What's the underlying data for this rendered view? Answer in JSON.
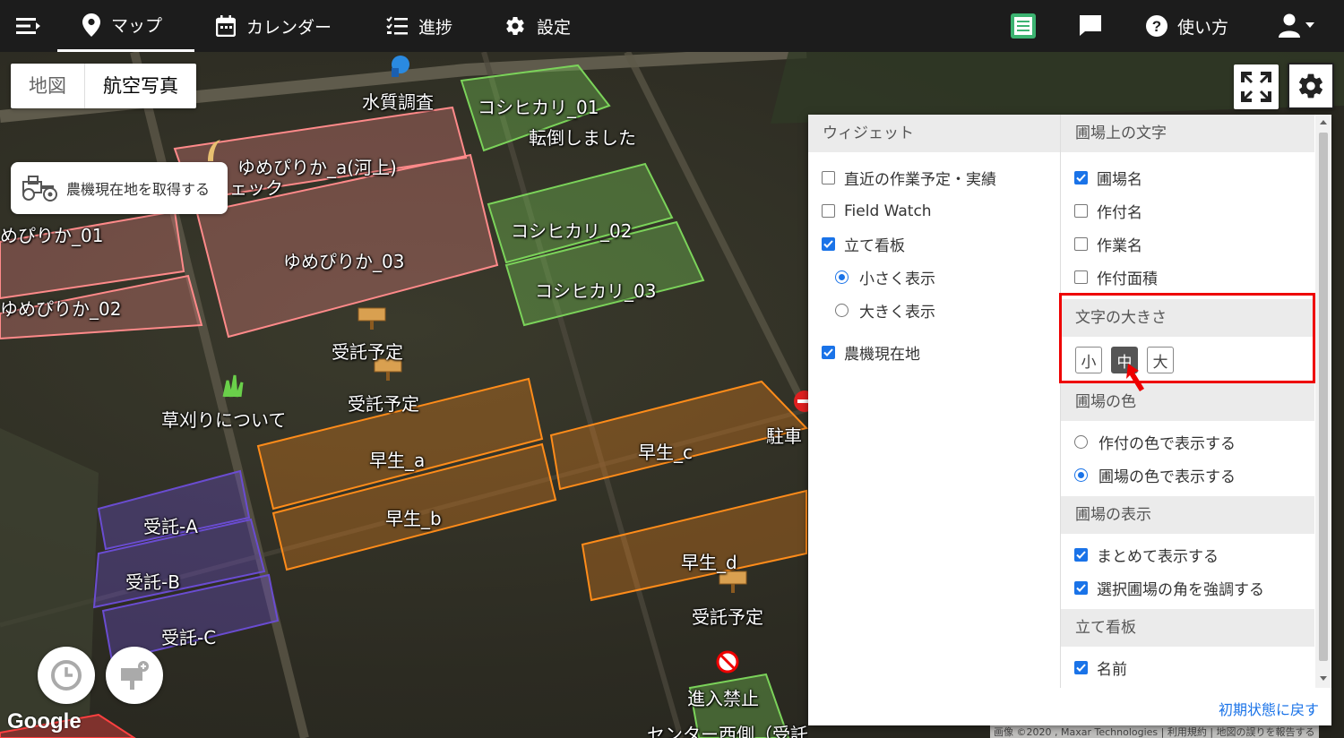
{
  "nav": {
    "tabs": [
      {
        "label": "マップ",
        "icon": "map-pin-icon"
      },
      {
        "label": "カレンダー",
        "icon": "calendar-icon"
      },
      {
        "label": "進捗",
        "icon": "list-icon"
      },
      {
        "label": "設定",
        "icon": "gear-icon"
      }
    ],
    "help_label": "使い方",
    "icons": [
      "menu-icon",
      "notebook-icon",
      "chat-icon",
      "help-icon",
      "user-icon"
    ],
    "bg_color": "#1c1c1c"
  },
  "map": {
    "type_buttons": {
      "map": "地図",
      "satellite": "航空写真"
    },
    "tractor_label": "農機現在地を取得する",
    "field_labels": [
      "水質調査",
      "コシヒカリ_01",
      "転倒しました",
      "ゆめぴりか_a(河上)",
      "ェック",
      "めぴりか_01",
      "ゆめぴりか_03",
      "コシヒカリ_02",
      "コシヒカリ_03",
      "ゆめぴりか_02",
      "受託予定",
      "受託予定",
      "草刈りについて",
      "早生_a",
      "早生_b",
      "早生_c",
      "駐車",
      "早生_d",
      "受託予定",
      "受託-A",
      "受託-B",
      "受託-C",
      "進入禁止",
      "センター西側（受託)"
    ],
    "google_logo": "Google",
    "attribution": "画像 ©2020 , Maxar Technologies  |  利用規約  |  地図の誤りを報告する",
    "field_colors": {
      "pink": "#ff8a8a",
      "green": "#7bd35a",
      "orange": "#ff8c1a",
      "purple": "#6a4cd1"
    }
  },
  "panel": {
    "left": {
      "header": "ウィジェット",
      "options": [
        {
          "label": "直近の作業予定・実績",
          "checked": false
        },
        {
          "label": "Field Watch",
          "checked": false
        },
        {
          "label": "立て看板",
          "checked": true
        },
        {
          "label": "小さく表示",
          "radio": true,
          "checked": true
        },
        {
          "label": "大きく表示",
          "radio": true,
          "checked": false
        },
        {
          "label": "農機現在地",
          "checked": true
        }
      ]
    },
    "right": {
      "field_text_header": "圃場上の文字",
      "field_text_options": [
        {
          "label": "圃場名",
          "checked": true
        },
        {
          "label": "作付名",
          "checked": false
        },
        {
          "label": "作業名",
          "checked": false
        },
        {
          "label": "作付面積",
          "checked": false
        }
      ],
      "text_size_header": "文字の大きさ",
      "text_sizes": [
        {
          "label": "小",
          "selected": false
        },
        {
          "label": "中",
          "selected": true
        },
        {
          "label": "大",
          "selected": false
        }
      ],
      "field_color_header": "圃場の色",
      "field_color_options": [
        {
          "label": "作付の色で表示する",
          "checked": false
        },
        {
          "label": "圃場の色で表示する",
          "checked": true
        }
      ],
      "field_display_header": "圃場の表示",
      "field_display_options": [
        {
          "label": "まとめて表示する",
          "checked": true
        },
        {
          "label": "選択圃場の角を強調する",
          "checked": true
        }
      ],
      "signboard_header": "立て看板",
      "signboard_options": [
        {
          "label": "名前",
          "checked": true
        }
      ]
    },
    "reset_label": "初期状態に戻す",
    "accent_color": "#1a73e8",
    "highlight_color": "#e00000"
  }
}
